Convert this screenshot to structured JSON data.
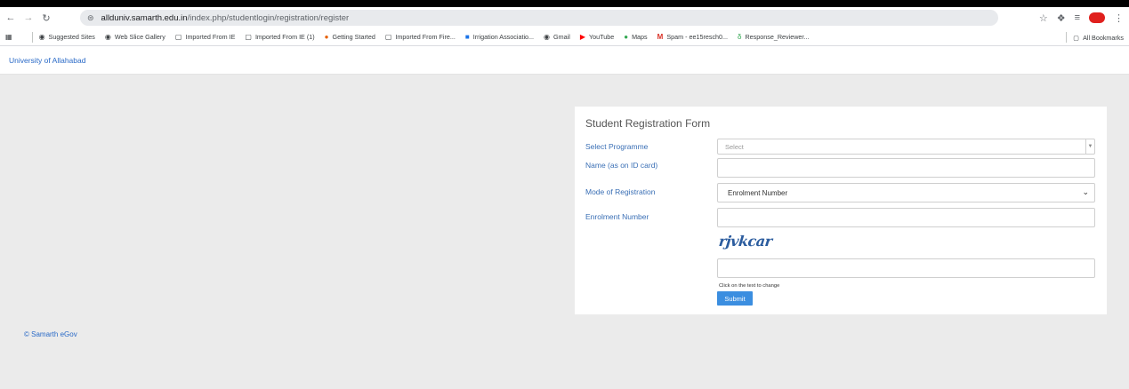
{
  "browser": {
    "url_host": "allduniv.samarth.edu.in",
    "url_path": "/index.php/studentlogin/registration/register",
    "bookmarks": [
      {
        "label": "Suggested Sites",
        "icon": "globe-icon"
      },
      {
        "label": "Web Slice Gallery",
        "icon": "globe-icon"
      },
      {
        "label": "Imported From IE",
        "icon": "folder-icon"
      },
      {
        "label": "Imported From IE (1)",
        "icon": "folder-icon"
      },
      {
        "label": "Getting Started",
        "icon": "firefox-icon"
      },
      {
        "label": "Imported From Fire...",
        "icon": "folder-icon"
      },
      {
        "label": "Irrigation Associatio...",
        "icon": "info-icon"
      },
      {
        "label": "Gmail",
        "icon": "globe-icon"
      },
      {
        "label": "YouTube",
        "icon": "youtube-icon"
      },
      {
        "label": "Maps",
        "icon": "maps-icon"
      },
      {
        "label": "Spam - ee15resch0...",
        "icon": "gmail-icon"
      },
      {
        "label": "Response_Reviewer...",
        "icon": "sprout-icon"
      }
    ],
    "all_bookmarks": "All Bookmarks"
  },
  "app": {
    "brand": "University of Allahabad",
    "footer": "© Samarth eGov"
  },
  "form": {
    "title": "Student Registration Form",
    "programme_label": "Select Programme",
    "programme_placeholder": "Select",
    "name_label": "Name (as on ID card)",
    "name_value": "",
    "mode_label": "Mode of Registration",
    "mode_value": "Enrolment Number",
    "enrolment_label": "Enrolment Number",
    "enrolment_value": "",
    "captcha_text": "rjvkcar",
    "captcha_value": "",
    "captcha_hint": "Click on the text to change",
    "submit_label": "Submit"
  },
  "colors": {
    "accent": "#3b8ee0",
    "link": "#2a6ac7",
    "page_bg": "#ebebeb",
    "profile": "#e0201d"
  }
}
